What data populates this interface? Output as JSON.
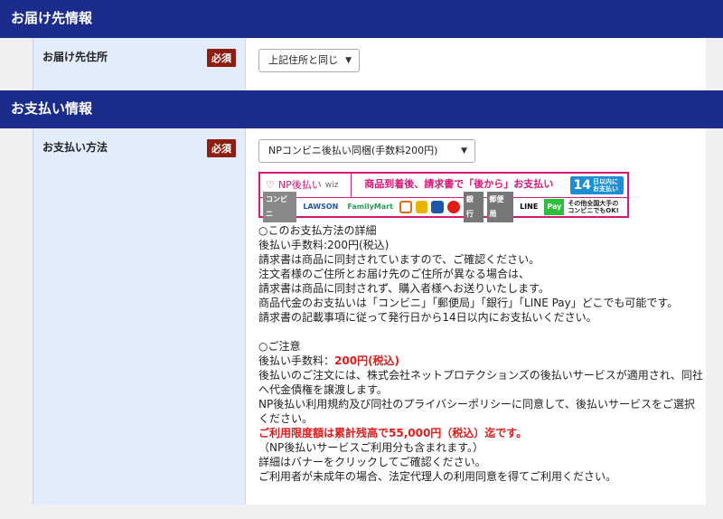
{
  "delivery": {
    "header": "お届け先情報",
    "address_label": "お届け先住所",
    "required": "必須",
    "address_select": "上記住所と同じ"
  },
  "payment": {
    "header": "お支払い情報",
    "method_label": "お支払い方法",
    "required": "必須",
    "method_select": "NPコンビニ後払い同梱(手数料200円)",
    "banner": {
      "logo": "NP後払い",
      "logo_sub": "wiz",
      "tagline": "商品到着後、請求書で「後から」お支払い",
      "days_num": "14",
      "days_text": "日以内に お支払い",
      "conv": "コンビニ",
      "lawson": "LAWSON",
      "familymart": "FamilyMart",
      "bank": "銀行",
      "post": "郵便局",
      "line": "LINE",
      "pay": "Pay",
      "other": "その他全国大手の コンビニでもOK!"
    },
    "details": [
      "○このお支払方法の詳細",
      "後払い手数料:200円(税込)",
      "請求書は商品に同封されていますので、ご確認ください。",
      "注文者様のご住所とお届け先のご住所が異なる場合は、",
      "請求書は商品に同封されず、購入者様へお送りいたします。",
      "商品代金のお支払いは「コンビニ」「郵便局」「銀行」「LINE Pay」どこでも可能です。",
      "請求書の記載事項に従って発行日から14日以内にお支払いください。"
    ],
    "notice_title": "○ご注意",
    "fee_prefix": "後払い手数料：",
    "fee_value": "200円(税込)",
    "notice_lines": [
      "後払いのご注文には、株式会社ネットプロテクションズの後払いサービスが適用され、同社へ代金債権を譲渡します。",
      "NP後払い利用規約及び同社のプライバシーポリシーに同意して、後払いサービスをご選択ください。"
    ],
    "limit_notice": "ご利用限度額は累計残高で55,000円（税込）迄です。",
    "limit_note": "（NP後払いサービスご利用分も含まれます。）",
    "banner_note": "詳細はバナーをクリックしてご確認ください。",
    "minor_note": "ご利用者が未成年の場合、法定代理人の利用同意を得てご利用ください。"
  }
}
